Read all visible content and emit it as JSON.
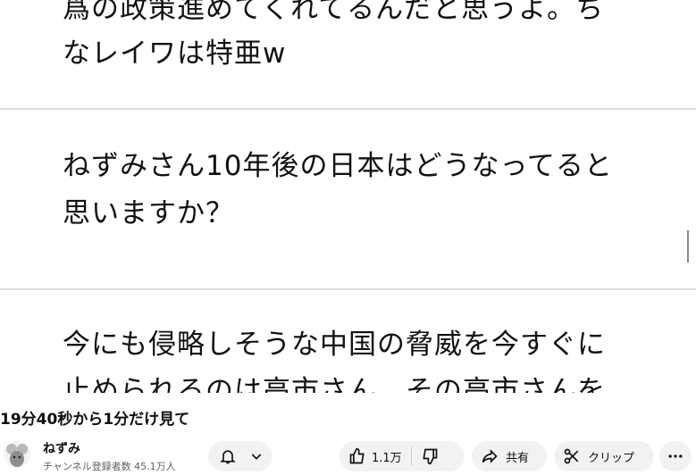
{
  "video": {
    "text_top": "爲の政策進めてくれてるんだと思うよ。ち",
    "text_top2": "なレイワは特亜w",
    "question_1": "ねずみさん10年後の日本はどうなってると",
    "question_1b": "思いますか？",
    "question_2": "今にも侵略しそうな中国の脅威を今すぐに",
    "question_2b": "止められるのは高市さん、その高市さんを"
  },
  "title": "19分40秒から1分だけ見て",
  "channel": {
    "name": "ねずみ",
    "subscribers": "チャンネル登録者数 45.1万人"
  },
  "actions": {
    "like_count": "1.1万",
    "share": "共有",
    "clip": "クリップ"
  },
  "icons": {
    "bell": "bell-icon",
    "chevron": "chevron-down-icon",
    "like": "thumbs-up-icon",
    "dislike": "thumbs-down-icon",
    "share": "share-arrow-icon",
    "clip": "scissors-icon",
    "more": "more-horizontal-icon"
  },
  "colors": {
    "pill_bg": "#f2f2f2",
    "text": "#0f0f0f",
    "muted": "#606060"
  }
}
